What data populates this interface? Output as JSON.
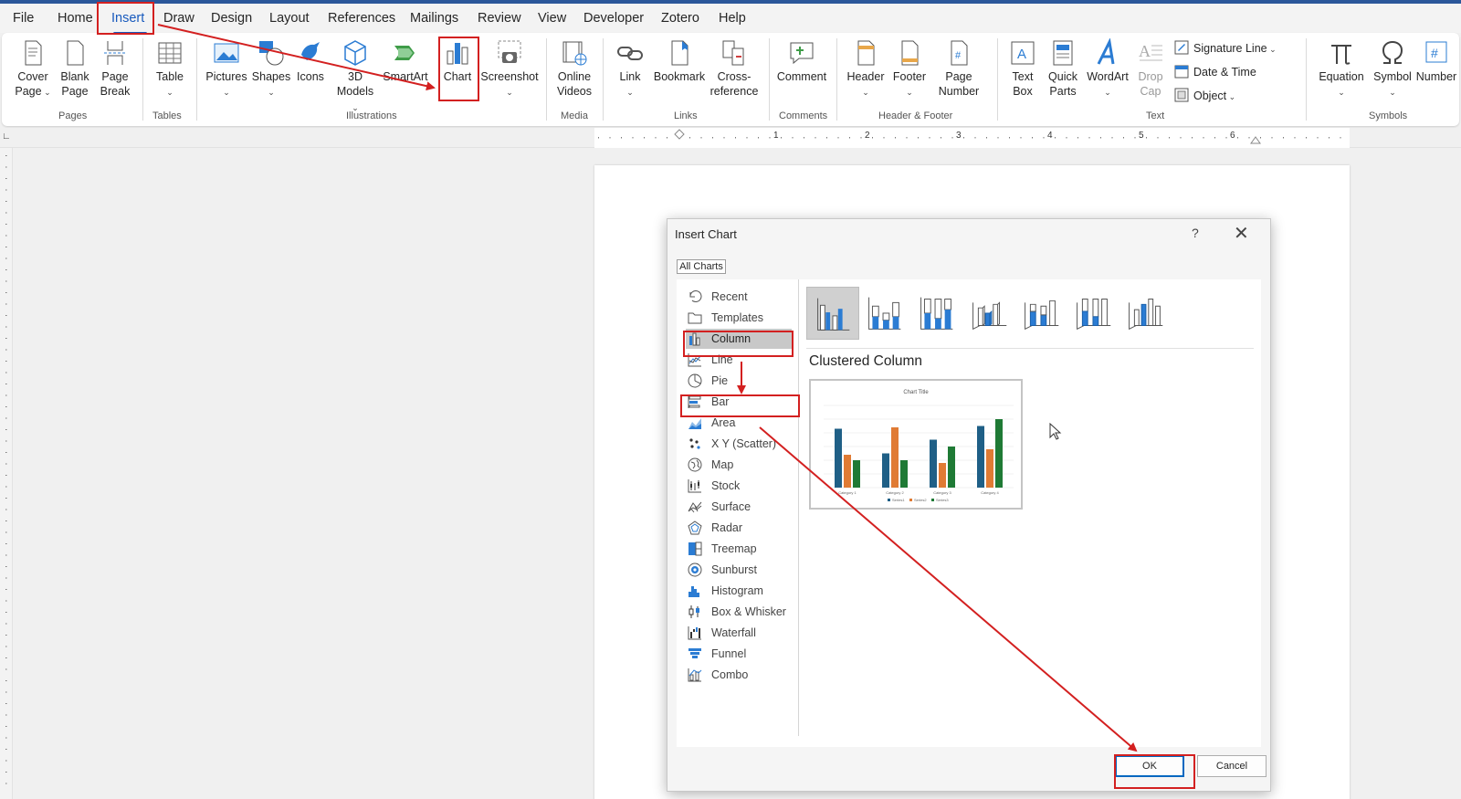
{
  "menubar": {
    "tabs": [
      "File",
      "Home",
      "Insert",
      "Draw",
      "Design",
      "Layout",
      "References",
      "Mailings",
      "Review",
      "View",
      "Developer",
      "Zotero",
      "Help"
    ],
    "active_tab": "Insert"
  },
  "ribbon": {
    "pages": {
      "cover_page": "Cover Page",
      "blank_page": "Blank Page",
      "page_break": "Page Break",
      "label": "Pages"
    },
    "tables": {
      "table": "Table",
      "label": "Tables"
    },
    "illustrations": {
      "pictures": "Pictures",
      "shapes": "Shapes",
      "icons": "Icons",
      "models_3d": "3D Models",
      "smartart": "SmartArt",
      "chart": "Chart",
      "screenshot": "Screenshot",
      "label": "Illustrations"
    },
    "media": {
      "online_videos": "Online Videos",
      "label": "Media"
    },
    "links": {
      "link": "Link",
      "bookmark": "Bookmark",
      "cross_reference": "Cross-reference",
      "label": "Links"
    },
    "comments": {
      "comment": "Comment",
      "label": "Comments"
    },
    "header_footer": {
      "header": "Header",
      "footer": "Footer",
      "page_number": "Page Number",
      "label": "Header & Footer"
    },
    "text": {
      "text_box": "Text Box",
      "quick_parts": "Quick Parts",
      "wordart": "WordArt",
      "drop_cap": "Drop Cap",
      "signature_line": "Signature Line",
      "date_time": "Date & Time",
      "object": "Object",
      "label": "Text"
    },
    "symbols": {
      "equation": "Equation",
      "symbol": "Symbol",
      "number": "Number",
      "label": "Symbols"
    }
  },
  "ruler": {
    "marks": [
      "1",
      "2",
      "3",
      "4",
      "5",
      "6"
    ]
  },
  "dialog": {
    "title": "Insert Chart",
    "help": "?",
    "close": "✕",
    "tab": "All Charts",
    "categories": [
      "Recent",
      "Templates",
      "Column",
      "Line",
      "Pie",
      "Bar",
      "Area",
      "X Y (Scatter)",
      "Map",
      "Stock",
      "Surface",
      "Radar",
      "Treemap",
      "Sunburst",
      "Histogram",
      "Box & Whisker",
      "Waterfall",
      "Funnel",
      "Combo"
    ],
    "selected_category": "Column",
    "preview_title": "Clustered Column",
    "preview": {
      "chart_title": "Chart Title",
      "categories": [
        "Category 1",
        "Category 2",
        "Category 3",
        "Category 4"
      ],
      "series_names": [
        "Series1",
        "Series2",
        "Series3"
      ],
      "colors": [
        "#1f5f86",
        "#e07b34",
        "#1f7a35"
      ]
    },
    "ok": "OK",
    "cancel": "Cancel"
  },
  "annotations": {
    "color": "#d32020"
  }
}
